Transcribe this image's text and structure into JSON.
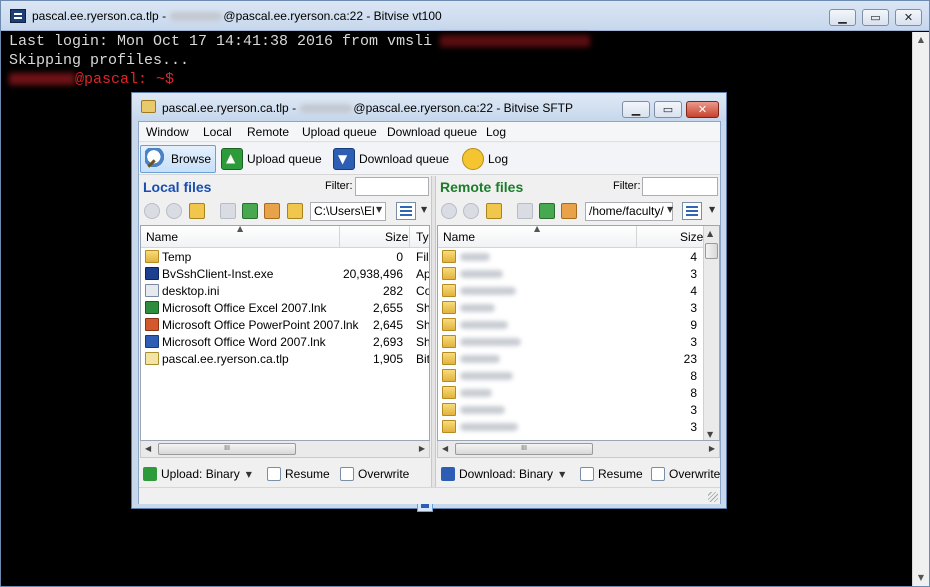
{
  "vt": {
    "title_prefix": "pascal.ee.ryerson.ca.tlp - ",
    "title_suffix": "@pascal.ee.ryerson.ca:22 - Bitvise vt100",
    "terminal": {
      "line1": "Last login: Mon Oct 17 14:41:38 2016 from vmsli",
      "line2": "Skipping profiles...",
      "prompt": "@pascal: ~$"
    }
  },
  "sftp": {
    "title_prefix": "pascal.ee.ryerson.ca.tlp - ",
    "title_suffix": "@pascal.ee.ryerson.ca:22 - Bitvise SFTP",
    "menu": [
      "Window",
      "Local",
      "Remote",
      "Upload queue",
      "Download queue",
      "Log"
    ],
    "toolbar": {
      "browse": "Browse",
      "upload_queue": "Upload queue",
      "download_queue": "Download queue",
      "log": "Log"
    },
    "local": {
      "title": "Local files",
      "filter_label": "Filter:",
      "path": "C:\\Users\\El",
      "col_name": "Name",
      "col_size": "Size",
      "col_type": "Ty",
      "files": [
        {
          "name": "Temp",
          "size": "0",
          "type": "File",
          "icon": "folder"
        },
        {
          "name": "BvSshClient-Inst.exe",
          "size": "20,938,496",
          "type": "App",
          "icon": "exe"
        },
        {
          "name": "desktop.ini",
          "size": "282",
          "type": "Cor",
          "icon": "ini"
        },
        {
          "name": "Microsoft Office Excel 2007.lnk",
          "size": "2,655",
          "type": "Sho",
          "icon": "xls"
        },
        {
          "name": "Microsoft Office PowerPoint 2007.lnk",
          "size": "2,645",
          "type": "Sho",
          "icon": "ppt"
        },
        {
          "name": "Microsoft Office Word 2007.lnk",
          "size": "2,693",
          "type": "Sho",
          "icon": "doc"
        },
        {
          "name": "pascal.ee.ryerson.ca.tlp",
          "size": "1,905",
          "type": "Bitv",
          "icon": "tlp"
        }
      ],
      "upload_mode": "Upload: Binary",
      "resume": "Resume",
      "overwrite": "Overwrite"
    },
    "remote": {
      "title": "Remote files",
      "filter_label": "Filter:",
      "path": "/home/faculty/",
      "col_name": "Name",
      "col_size": "Size",
      "sizes": [
        "4",
        "3",
        "4",
        "3",
        "9",
        "3",
        "23",
        "8",
        "8",
        "3",
        "3"
      ],
      "download_mode": "Download: Binary",
      "resume": "Resume",
      "overwrite": "Overwrite"
    },
    "scroll_thumb": "III"
  }
}
